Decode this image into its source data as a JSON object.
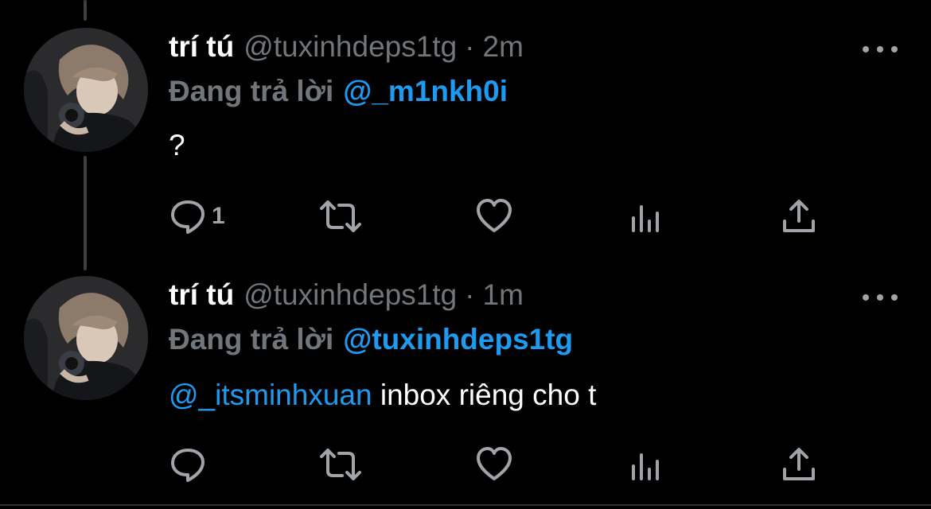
{
  "tweets": [
    {
      "display_name": "trí tú",
      "handle": "@tuxinhdeps1tg",
      "separator": "·",
      "time": "2m",
      "replying_label": "Đang trả lời",
      "replying_to": "@_m1nkh0i",
      "text": "?",
      "reply_count": "1"
    },
    {
      "display_name": "trí tú",
      "handle": "@tuxinhdeps1tg",
      "separator": "·",
      "time": "1m",
      "replying_label": "Đang trả lời",
      "replying_to": "@tuxinhdeps1tg",
      "text_mention": "@_itsminhxuan",
      "text": " inbox riêng cho t"
    }
  ],
  "colors": {
    "background": "#000000",
    "primary_text": "#ffffff",
    "secondary_text": "#71767b",
    "link": "#1d9bf0",
    "icon": "#a0a4a8"
  },
  "icons": [
    "reply-icon",
    "retweet-icon",
    "like-icon",
    "analytics-icon",
    "share-icon",
    "more-icon"
  ]
}
